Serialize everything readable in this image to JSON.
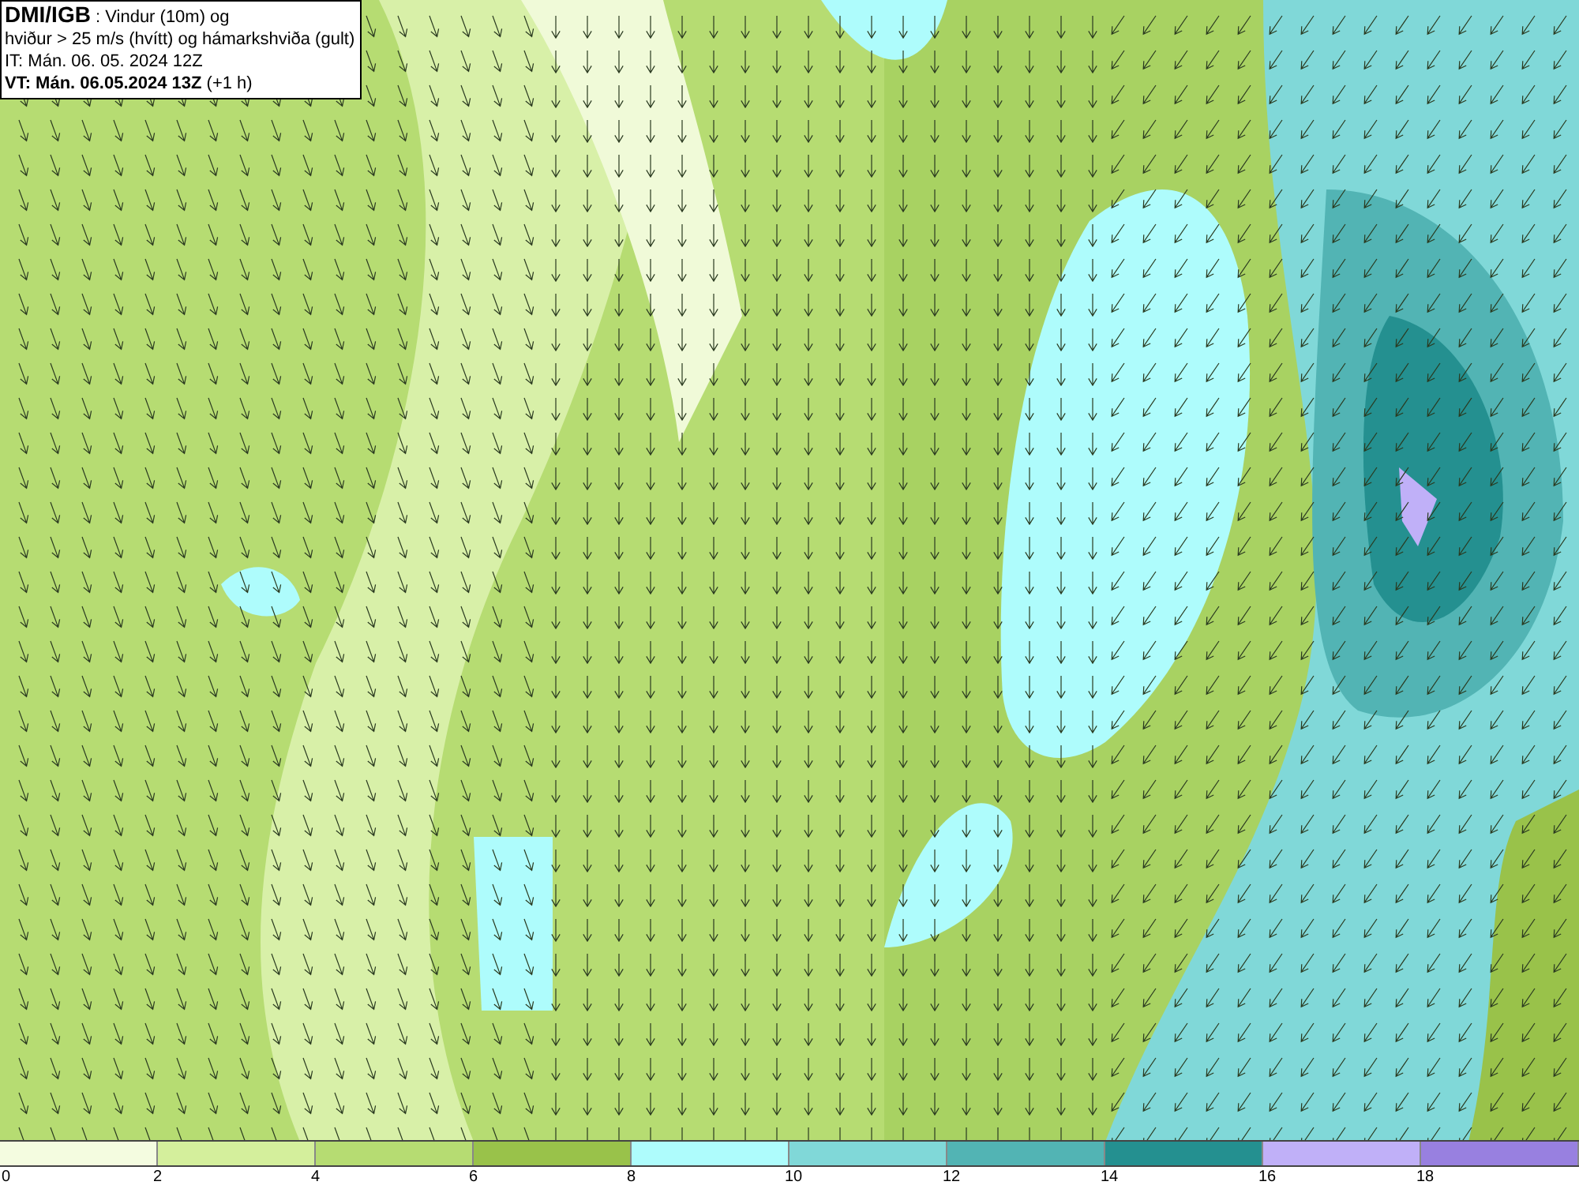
{
  "header": {
    "lines": [
      "**DMI/IGB** : Vindur (10m) og",
      "hviður > 25 m/s (hvítt) og hámarkshviða (gult)",
      "IT: Mán. 06. 05. 2024 12Z",
      "**VT: Mán. 06.05.2024 13Z** (+1 h)"
    ]
  },
  "legend": {
    "swatches": [
      {
        "color": "#f4fce0"
      },
      {
        "color": "#d4ef9c"
      },
      {
        "color": "#b6dc72"
      },
      {
        "color": "#99c24a"
      },
      {
        "color": "#aefcfc"
      },
      {
        "color": "#80d8d8"
      },
      {
        "color": "#52b4b4"
      },
      {
        "color": "#249090"
      },
      {
        "color": "#c0b0f8"
      },
      {
        "color": "#9880e0"
      }
    ],
    "ticks": [
      "0",
      "2",
      "4",
      "6",
      "8",
      "10",
      "12",
      "14",
      "16",
      "18"
    ]
  }
}
